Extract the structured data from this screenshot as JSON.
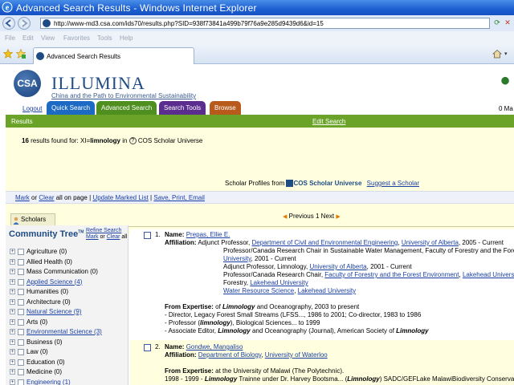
{
  "window": {
    "title": "Advanced Search Results - Windows Internet Explorer",
    "url": "http://www-md3.csa.com/ids70/results.php?SID=938f73841a499b79f76a9e285d9439d6&id=15",
    "tab_title": "Advanced Search Results",
    "menu": [
      "File",
      "Edit",
      "View",
      "Favorites",
      "Tools",
      "Help"
    ]
  },
  "header": {
    "logo_text": "CSA",
    "brand": "ILLUMINA",
    "tagline": "China and the Path to Environmental Sustainability",
    "logout": "Logout",
    "right_text": "0 Ma",
    "tabs": [
      {
        "label": "Quick Search",
        "color": "#1c6ac4"
      },
      {
        "label": "Advanced Search",
        "color": "#4e8f1f"
      },
      {
        "label": "Search Tools",
        "color": "#5a2d8f"
      },
      {
        "label": "Browse",
        "color": "#b85a1c"
      }
    ]
  },
  "results_bar": {
    "label": "Results",
    "edit": "Edit Search"
  },
  "info": {
    "count": "16",
    "found_text": "results found for: XI=",
    "query": "limnology",
    "in_text": "in",
    "database": "COS Scholar Universe",
    "scholars_tab": "Scholars 16"
  },
  "profiles": {
    "prefix": "Scholar Profiles from",
    "cos": "COS",
    "scholar_universe": "Scholar Universe",
    "suggest": "Suggest a Scholar"
  },
  "actionbar": {
    "mark": "Mark",
    "or": "or",
    "clear": "Clear",
    "all_on_page": "all on page",
    "sep": "|",
    "update": "Update Marked List",
    "save": "Save, Print, Email"
  },
  "pager": {
    "previous": "Previous",
    "page": "1",
    "next": "Next"
  },
  "tree": {
    "title": "Community Tree",
    "tm": "TM",
    "refine": "Refine Search",
    "mark": "Mark",
    "or": "or",
    "clear": "Clear",
    "all": "all",
    "items": [
      {
        "label": "Agriculture (0)",
        "link": false
      },
      {
        "label": "Allied Health (0)",
        "link": false
      },
      {
        "label": "Mass Communication (0)",
        "link": false
      },
      {
        "label": "Applied Science (4)",
        "link": true
      },
      {
        "label": "Humanities (0)",
        "link": false
      },
      {
        "label": "Architecture (0)",
        "link": false
      },
      {
        "label": "Natural Science (9)",
        "link": true
      },
      {
        "label": "Arts (0)",
        "link": false
      },
      {
        "label": "Environmental Science (3)",
        "link": true
      },
      {
        "label": "Business (0)",
        "link": false
      },
      {
        "label": "Law (0)",
        "link": false
      },
      {
        "label": "Education (0)",
        "link": false
      },
      {
        "label": "Medicine (0)",
        "link": false
      },
      {
        "label": "Engineering (1)",
        "link": true
      }
    ]
  },
  "results": [
    {
      "num": "1.",
      "name_label": "Name:",
      "name": "Prepas, Ellie E.",
      "aff_label": "Affiliation:",
      "aff1_pre": "Adjunct Professor,",
      "aff1_dept": "Department of Civil and Environmental Engineering",
      "aff1_univ": "University of Alberta",
      "aff1_post": ", 2005 - Current",
      "aff2_line1": "Professor/Canada Research Chair in Sustainable Water Management, Faculty of Forestry and the Forest Envi",
      "aff2_link": "University",
      "aff2_post": ", 2001 - Current",
      "aff3_pre": "Adjunct Professor, Limnology,",
      "aff3_univ": "University of Alberta",
      "aff3_post": ", 2001 - Current",
      "aff4_pre": "Professor/Canada Research Chair,",
      "aff4_fac": "Faculty of Forestry and the Forest Environment",
      "aff4_univ": "Lakehead University",
      "aff5_pre": "Forestry,",
      "aff5_univ": "Lakehead University",
      "aff6_link1": "Water Resource Science",
      "aff6_link2": "Lakehead University",
      "exp_label": "From Expertise:",
      "exp1_pre": "of",
      "exp1_bold": "Limnology",
      "exp1_post": "and Oceanography, 2003 to present",
      "exp2": "- Director, Legacy Forest Small Streams (LFSS..., 1986 to 2001; Co-director, 1983 to 1986",
      "exp3_pre": "- Professor (",
      "exp3_bold": "limnology",
      "exp3_post": "), Biological Sciences... to 1999",
      "exp4_pre": "- Associate Editor,",
      "exp4_bold1": "Limnology",
      "exp4_mid": "and Oceanography (Journal), American Society of",
      "exp4_bold2": "Limnology"
    },
    {
      "num": "2.",
      "name_label": "Name:",
      "name": "Gondwe, Mangaliso",
      "aff_label": "Affiliation:",
      "aff1_dept": "Department of Biology",
      "aff1_univ": "University of Waterloo",
      "exp_label": "From Expertise:",
      "exp1": "at the University of Malawi (The Polytechnic).",
      "exp2_pre": "1998 - 1999 -",
      "exp2_bold1": "Limnology",
      "exp2_mid": "Trainne under Dr. Harvey Bootsma... (",
      "exp2_bold2": "Limnology",
      "exp2_post": ") SADC/GEFLake MalawiBiodiversity Conserva"
    }
  ]
}
